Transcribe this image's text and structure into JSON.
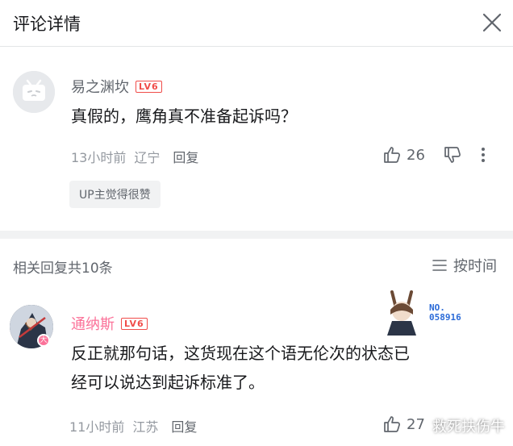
{
  "header": {
    "title": "评论详情",
    "close_icon": "close-icon"
  },
  "root_comment": {
    "username": "易之渊坎",
    "level": "LV6",
    "content": "真假的，鹰角真不准备起诉吗？",
    "time": "13小时前",
    "location": "辽宁",
    "reply_label": "回复",
    "likes": "26",
    "up_tag": "UP主觉得很赞"
  },
  "replies": {
    "header": "相关回复共10条",
    "sort_label": "按时间"
  },
  "reply_comment": {
    "username": "通纳斯",
    "level": "LV6",
    "content_line1": "反正就那句话，这货现在这个语无伦次的状态已",
    "content_line2": "经可以说达到起诉标准了。",
    "time": "11小时前",
    "location": "江苏",
    "reply_label": "回复",
    "likes": "27",
    "fan_no_label": "NO.",
    "fan_no": "058916"
  },
  "watermark": "救死扶伤牛",
  "colors": {
    "username_root": "#61666d",
    "username_reply": "#fb7299",
    "level_badge": "#f04c49",
    "meta_gray": "#9499a0",
    "divider": "#f1f2f3"
  }
}
